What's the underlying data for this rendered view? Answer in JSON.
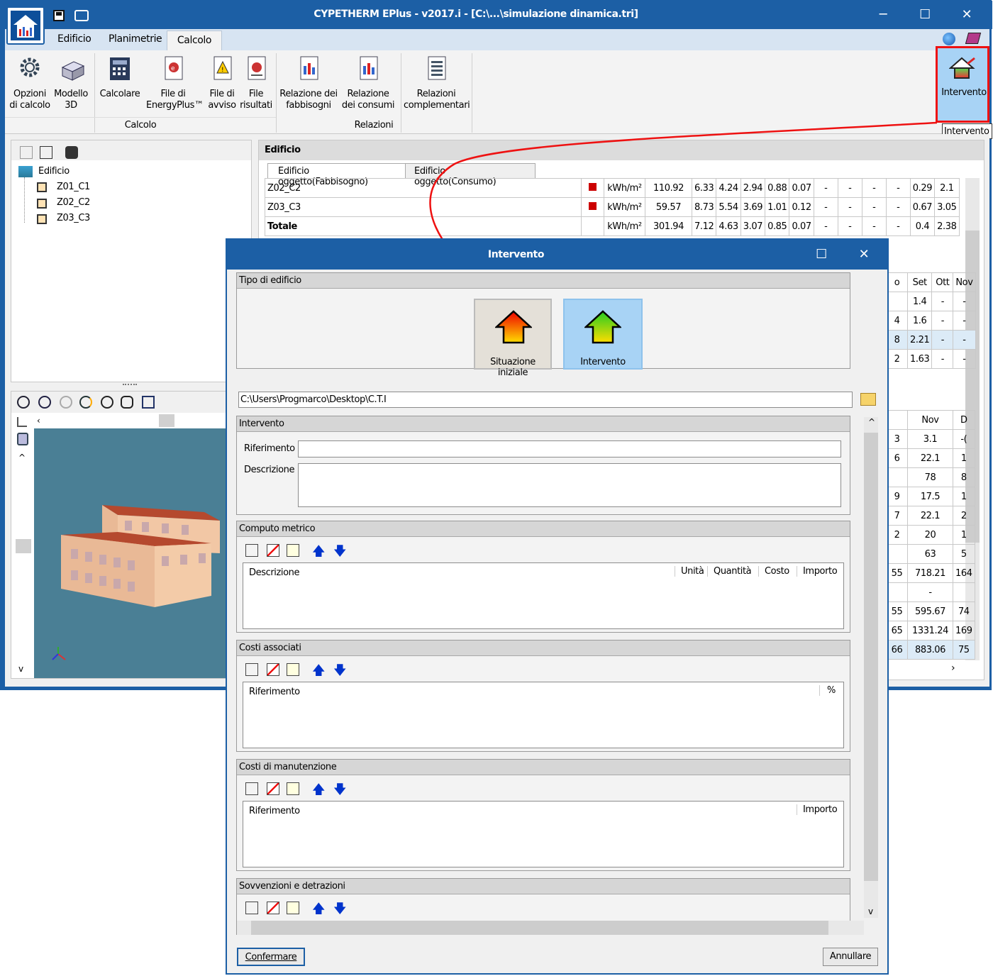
{
  "window": {
    "title": "CYPETHERM EPlus - v2017.i - [C:\\...\\simulazione dinamica.tri]"
  },
  "menu": {
    "items": [
      "Edificio",
      "Planimetrie",
      "Calcolo"
    ],
    "active": "Calcolo"
  },
  "ribbon": {
    "buttons": [
      {
        "l1": "Opzioni",
        "l2": "di calcolo"
      },
      {
        "l1": "Modello",
        "l2": "3D"
      },
      {
        "l1": "Calcolare",
        "l2": ""
      },
      {
        "l1": "File di",
        "l2": "EnergyPlus™"
      },
      {
        "l1": "File di",
        "l2": "avviso"
      },
      {
        "l1": "File",
        "l2": "risultati"
      },
      {
        "l1": "Relazione dei",
        "l2": "fabbisogni"
      },
      {
        "l1": "Relazione",
        "l2": "dei consumi"
      },
      {
        "l1": "Relazioni",
        "l2": "complementari"
      }
    ],
    "group_calcolo": "Calcolo",
    "group_relazioni": "Relazioni",
    "intervento": "Intervento",
    "tooltip": "Intervento"
  },
  "tree": {
    "root": "Edificio",
    "items": [
      "Z01_C1",
      "Z02_C2",
      "Z03_C3"
    ]
  },
  "grid": {
    "header": "Edificio",
    "tabs": [
      "Edificio oggetto(Fabbisogno)",
      "Edificio oggetto(Consumo)"
    ],
    "rows": [
      {
        "name": "Z02_C2",
        "unit": "kWh/m²",
        "vals": [
          "110.92",
          "6.33",
          "4.24",
          "2.94",
          "0.88",
          "0.07",
          "-",
          "-",
          "-",
          "-",
          "0.29",
          "2.1"
        ]
      },
      {
        "name": "Z03_C3",
        "unit": "kWh/m²",
        "vals": [
          "59.57",
          "8.73",
          "5.54",
          "3.69",
          "1.01",
          "0.12",
          "-",
          "-",
          "-",
          "-",
          "0.67",
          "3.05"
        ]
      },
      {
        "name": "Totale",
        "unit": "kWh/m²",
        "vals": [
          "301.94",
          "7.12",
          "4.63",
          "3.07",
          "0.85",
          "0.07",
          "-",
          "-",
          "-",
          "-",
          "0.4",
          "2.38"
        ]
      }
    ],
    "table2": {
      "headers": [
        "o",
        "Set",
        "Ott",
        "Nov"
      ],
      "rows": [
        [
          "",
          "1.4",
          "-",
          "-"
        ],
        [
          "4",
          "1.6",
          "-",
          "-"
        ],
        [
          "8",
          "2.21",
          "-",
          "-"
        ],
        [
          "2",
          "1.63",
          "-",
          "-"
        ]
      ]
    },
    "table3": {
      "headers": [
        "",
        "Nov",
        "D"
      ],
      "rows": [
        [
          "3",
          "3.1",
          "-("
        ],
        [
          "6",
          "22.1",
          "1"
        ],
        [
          "",
          "78",
          "8"
        ],
        [
          "9",
          "17.5",
          "1"
        ],
        [
          "7",
          "22.1",
          "2"
        ],
        [
          "2",
          "20",
          "1"
        ],
        [
          "",
          "63",
          "5"
        ],
        [
          "55",
          "718.21",
          "164"
        ],
        [
          "",
          "-",
          ""
        ],
        [
          "55",
          "595.67",
          "74"
        ],
        [
          "65",
          "1331.24",
          "169"
        ],
        [
          "66",
          "883.06",
          "75"
        ]
      ]
    }
  },
  "dialog": {
    "title": "Intervento",
    "tipo": {
      "header": "Tipo di edificio",
      "opt1": "Situazione iniziale",
      "opt2": "Intervento"
    },
    "path": "C:\\Users\\Progmarco\\Desktop\\C.T.I",
    "intervento": {
      "header": "Intervento",
      "riferimento_label": "Riferimento",
      "descrizione_label": "Descrizione",
      "riferimento_value": "",
      "descrizione_value": ""
    },
    "computo": {
      "header": "Computo metrico",
      "cols": [
        "Descrizione",
        "Unità",
        "Quantità",
        "Costo",
        "Importo"
      ]
    },
    "costi": {
      "header": "Costi associati",
      "cols": [
        "Riferimento",
        "%"
      ]
    },
    "manut": {
      "header": "Costi di manutenzione",
      "cols": [
        "Riferimento",
        "Importo"
      ]
    },
    "sovv": {
      "header": "Sovvenzioni e detrazioni"
    },
    "confirm": "Confermare",
    "cancel": "Annullare"
  },
  "colors": {
    "titlebar": "#1c5fa5",
    "accent": "#a8d3f5",
    "highlight": "#e11111"
  }
}
